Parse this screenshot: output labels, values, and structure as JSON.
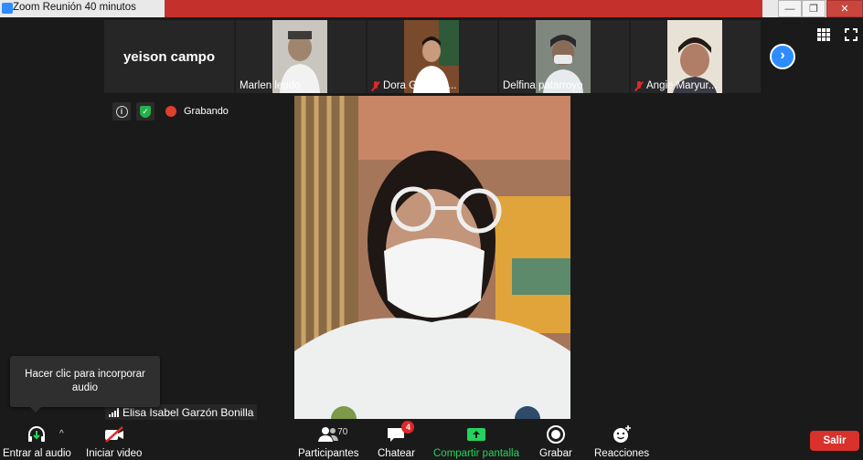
{
  "window": {
    "title": "Zoom Reunión 40 minutos",
    "minimize": "—",
    "maximize": "❐",
    "close": "✕"
  },
  "gallery": {
    "name_only_tile": "yeison campo",
    "participants": [
      {
        "name": "Marlen leudo",
        "muted": false
      },
      {
        "name": "Dora Galindo ...",
        "muted": true
      },
      {
        "name": "Delfina patarroyo",
        "muted": false
      },
      {
        "name": "Angie Maryur...",
        "muted": true
      }
    ],
    "next_symbol": "›"
  },
  "status": {
    "info_symbol": "i",
    "shield_symbol": "✓",
    "recording_label": "Grabando"
  },
  "speaker": {
    "name": "Elisa Isabel Garzón Bonilla"
  },
  "tooltip": {
    "text": "Hacer clic para incorporar audio"
  },
  "toolbar": {
    "audio_label": "Entrar al audio",
    "audio_caret": "^",
    "video_label": "Iniciar video",
    "participants_label": "Participantes",
    "participants_count": "70",
    "chat_label": "Chatear",
    "chat_badge": "4",
    "share_label": "Compartir pantalla",
    "record_label": "Grabar",
    "reactions_label": "Reacciones",
    "leave_label": "Salir"
  },
  "colors": {
    "accent": "#2d8cff",
    "share_green": "#23d35e",
    "leave_red": "#d9312b",
    "muted_red": "#e02828"
  }
}
